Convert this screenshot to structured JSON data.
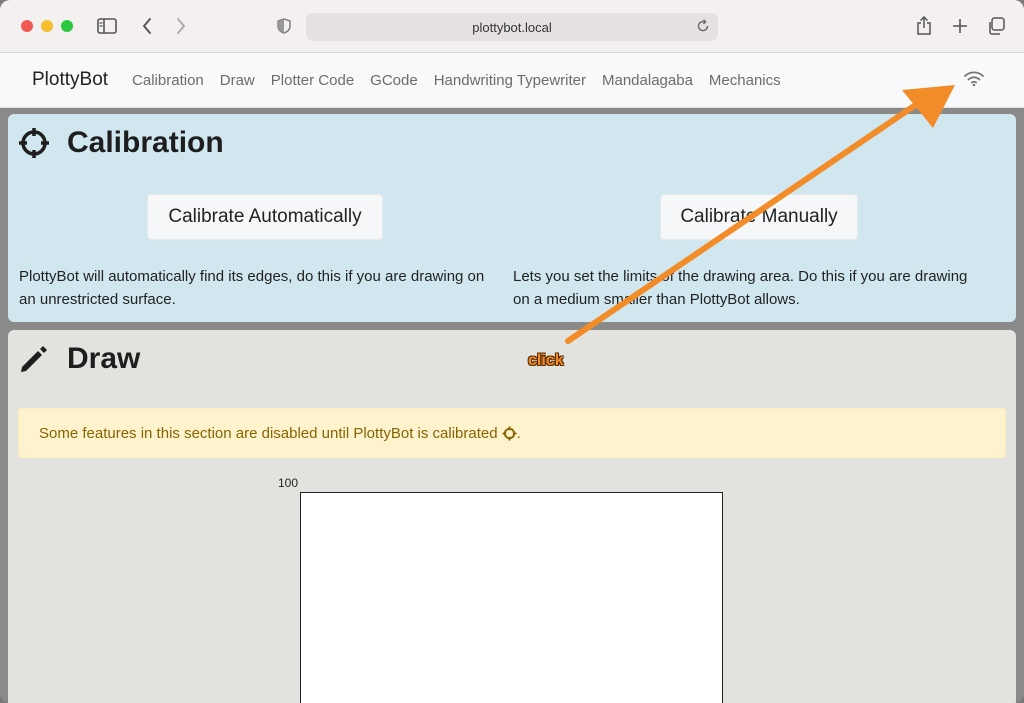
{
  "browser": {
    "url": "plottybot.local"
  },
  "navbar": {
    "brand": "PlottyBot",
    "links": [
      "Calibration",
      "Draw",
      "Plotter Code",
      "GCode",
      "Handwriting Typewriter",
      "Mandalagaba",
      "Mechanics"
    ],
    "status_icon": "wifi-icon"
  },
  "calibration": {
    "title": "Calibration",
    "icon": "crosshair-icon",
    "auto_button": "Calibrate Automatically",
    "manual_button": "Calibrate Manually",
    "auto_desc_line1": "PlottyBot will automatically find its edges, do this if you are drawing on",
    "auto_desc_line2": "an unrestricted surface.",
    "manual_desc_line1": "Lets you set the limits of the drawing area. Do this if you are drawing",
    "manual_desc_line2": "on a medium smaller than PlottyBot allows."
  },
  "draw": {
    "title": "Draw",
    "icon": "pencil-icon",
    "alert": "Some features in this section are disabled until PlottyBot is calibrated",
    "alert_suffix": ".",
    "axis_max": "100"
  },
  "annotation": {
    "label": "click",
    "color": "#f28c28"
  }
}
